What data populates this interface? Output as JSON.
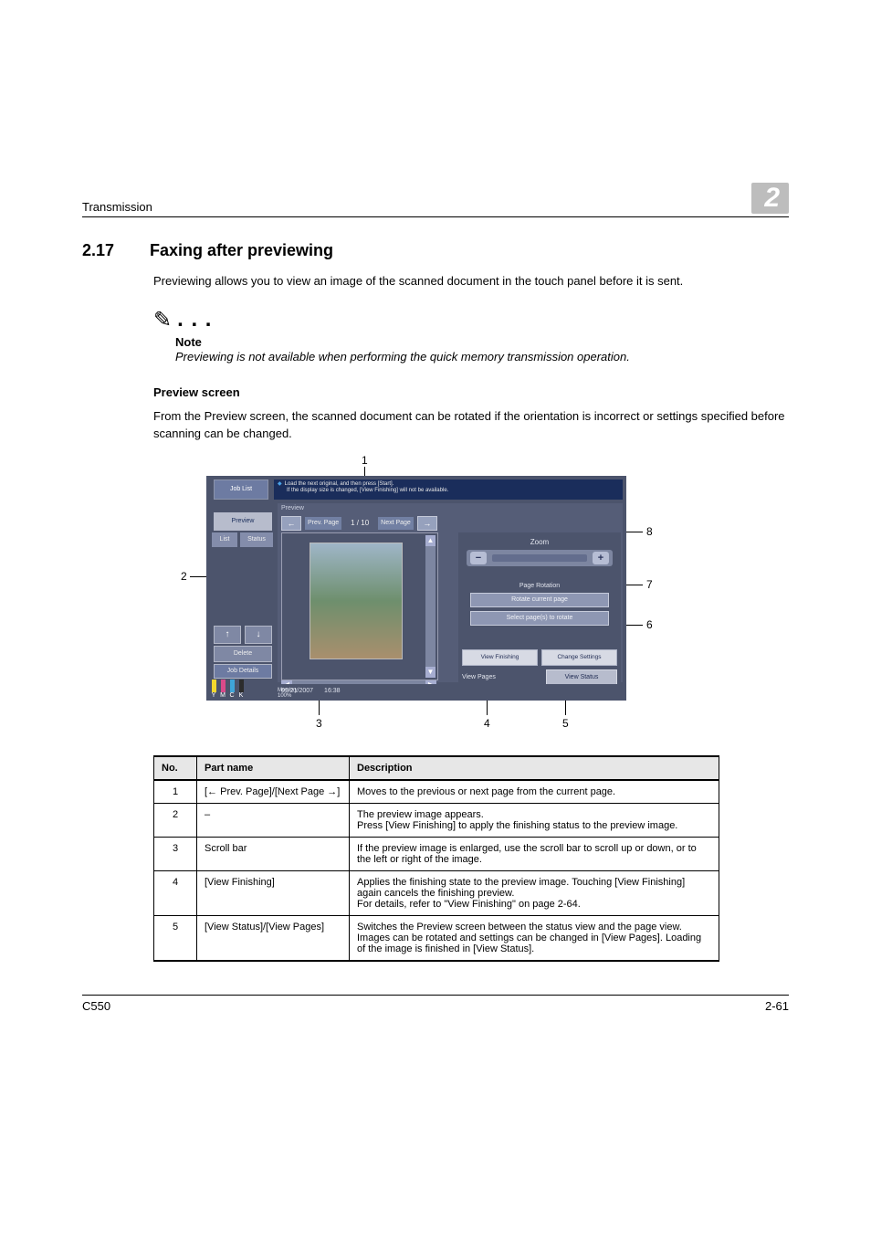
{
  "running_head": {
    "left": "Transmission",
    "chapter": "2"
  },
  "section": {
    "num": "2.17",
    "title": "Faxing after previewing",
    "intro": "Previewing allows you to view an image of the scanned document in the touch panel before it is sent."
  },
  "note": {
    "label": "Note",
    "text": "Previewing is not available when performing the quick memory transmission operation."
  },
  "subhead": "Preview screen",
  "subpara": "From the Preview screen, the scanned document can be rotated if the orientation is incorrect or settings specified before scanning can be changed.",
  "callouts": [
    "1",
    "2",
    "3",
    "4",
    "5",
    "6",
    "7",
    "8"
  ],
  "screen": {
    "joblist": "Job List",
    "banner1": "Load the next original, and then press [Start].",
    "banner2": "If the display size is changed, [View Finishing] will not be available.",
    "preview": "Preview",
    "list": "List",
    "status": "Status",
    "up": "↑",
    "down": "↓",
    "delete": "Delete",
    "jobdetails": "Job Details",
    "toners": [
      "Y",
      "M",
      "C",
      "K"
    ],
    "previewLabel": "Preview",
    "prevPage": "Prev. Page",
    "nextPage": "Next Page",
    "pageCount": "1 / 10",
    "leftArrow": "←",
    "rightArrow": "→",
    "zoom": "Zoom",
    "minus": "−",
    "plus": "+",
    "rotation": "Page Rotation",
    "rotateCurrent": "Rotate current page",
    "selectPages": "Select page(s) to rotate",
    "viewFinishing": "View Finishing",
    "changeSettings": "Change Settings",
    "viewPages": "View Pages",
    "viewStatus": "View Status",
    "date": "09/21/2007",
    "time": "16:38",
    "mem": "Memory",
    "memPct": "100%"
  },
  "table": {
    "headers": {
      "no": "No.",
      "part": "Part name",
      "desc": "Description"
    },
    "rows": [
      {
        "no": "1",
        "part": "[← Prev. Page]/[Next Page →]",
        "desc": "Moves to the previous or next page from the current page."
      },
      {
        "no": "2",
        "part": "–",
        "desc": "The preview image appears.\nPress [View Finishing] to apply the finishing status to the preview image."
      },
      {
        "no": "3",
        "part": "Scroll bar",
        "desc": "If the preview image is enlarged, use the scroll bar to scroll up or down, or to the left or right of the image."
      },
      {
        "no": "4",
        "part": "[View Finishing]",
        "desc": "Applies the finishing state to the preview image. Touching [View Finishing] again cancels the finishing preview.\nFor details, refer to \"View Finishing\" on page 2-64."
      },
      {
        "no": "5",
        "part": "[View Status]/[View Pages]",
        "desc": "Switches the Preview screen between the status view and the page view.\nImages can be rotated and settings can be changed in [View Pages]. Loading of the image is finished in [View Status]."
      }
    ]
  },
  "footer": {
    "left": "C550",
    "right": "2-61"
  }
}
